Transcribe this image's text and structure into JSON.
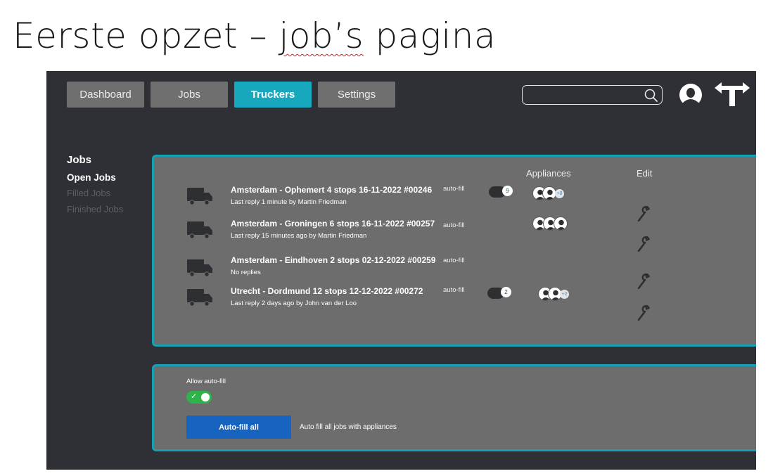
{
  "slide": {
    "title": "Eerste opzet – job’s pagina"
  },
  "nav": {
    "tabs": [
      {
        "label": "Dashboard",
        "active": false
      },
      {
        "label": "Jobs",
        "active": false
      },
      {
        "label": "Truckers",
        "active": true
      },
      {
        "label": "Settings",
        "active": false
      }
    ],
    "search": {
      "value": "",
      "placeholder": ""
    }
  },
  "sidebar": {
    "heading": "Jobs",
    "items": [
      {
        "label": "Open Jobs",
        "active": true
      },
      {
        "label": "Filled Jobs",
        "active": false
      },
      {
        "label": "Finished Jobs",
        "active": false
      }
    ]
  },
  "jobs_panel": {
    "appliances_header": "Appliances",
    "edit_header": "Edit",
    "jobs": [
      {
        "title": "Amsterdam - Ophemert 4 stops 16-11-2022 #00246",
        "subtitle": "Last reply 1 minute by Martin Friedman",
        "auto_fill": "auto-fill",
        "replies": "9",
        "appliance_more": "+8"
      },
      {
        "title": "Amsterdam - Groningen 6 stops 16-11-2022 #00257",
        "subtitle": "Last reply 15 minutes ago by Martin Friedman",
        "auto_fill": "auto-fill",
        "replies": "",
        "appliance_more": ""
      },
      {
        "title": "Amsterdam - Eindhoven 2 stops 02-12-2022 #00259",
        "subtitle": "No replies",
        "auto_fill": "auto-fill",
        "replies": "",
        "appliance_more": ""
      },
      {
        "title": "Utrecht - Dordmund 12 stops 12-12-2022 #00272",
        "subtitle": "Last reply 2 days ago by John van der Loo",
        "auto_fill": "auto-fill",
        "replies": "2",
        "appliance_more": "+2"
      }
    ]
  },
  "autofill_panel": {
    "allow_label": "Allow auto-fill",
    "toggle_on": true,
    "toggle_check": "✓",
    "button_label": "Auto-fill all",
    "description": "Auto fill all jobs with appliances"
  },
  "colors": {
    "background": "#2e3035",
    "accent": "#15a1b5",
    "panel": "#6d6d6d",
    "button_blue": "#1664c0",
    "toggle_green": "#2eb24a",
    "spellcheck_red": "#d42020"
  },
  "icons": [
    "search-icon",
    "profile-icon",
    "signpost-icon",
    "truck-icon",
    "chat-icon",
    "avatar-icon",
    "wrench-icon"
  ]
}
